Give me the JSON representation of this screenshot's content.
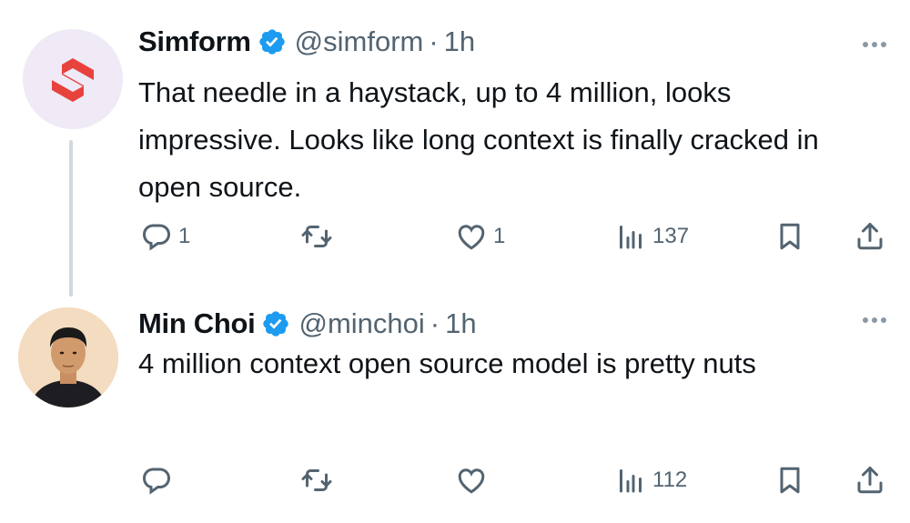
{
  "tweets": [
    {
      "display_name": "Simform",
      "handle": "@simform",
      "separator": "·",
      "time": "1h",
      "text": "That needle in a haystack, up to 4 million, looks impressive. Looks like long context is finally cracked in open source.",
      "reply_count": "1",
      "retweet_count": "",
      "like_count": "1",
      "view_count": "137",
      "avatar_icon": "simform-logo-icon",
      "brand_color": "#e8423d"
    },
    {
      "display_name": "Min Choi",
      "handle": "@minchoi",
      "separator": "·",
      "time": "1h",
      "text": "4 million context open source model is pretty nuts",
      "reply_count": "",
      "retweet_count": "",
      "like_count": "",
      "view_count": "112",
      "avatar_icon": "user-photo-avatar"
    }
  ],
  "colors": {
    "verified_badge": "#1d9bf0",
    "secondary_text": "#536471",
    "thread_line": "#cfd9de"
  }
}
